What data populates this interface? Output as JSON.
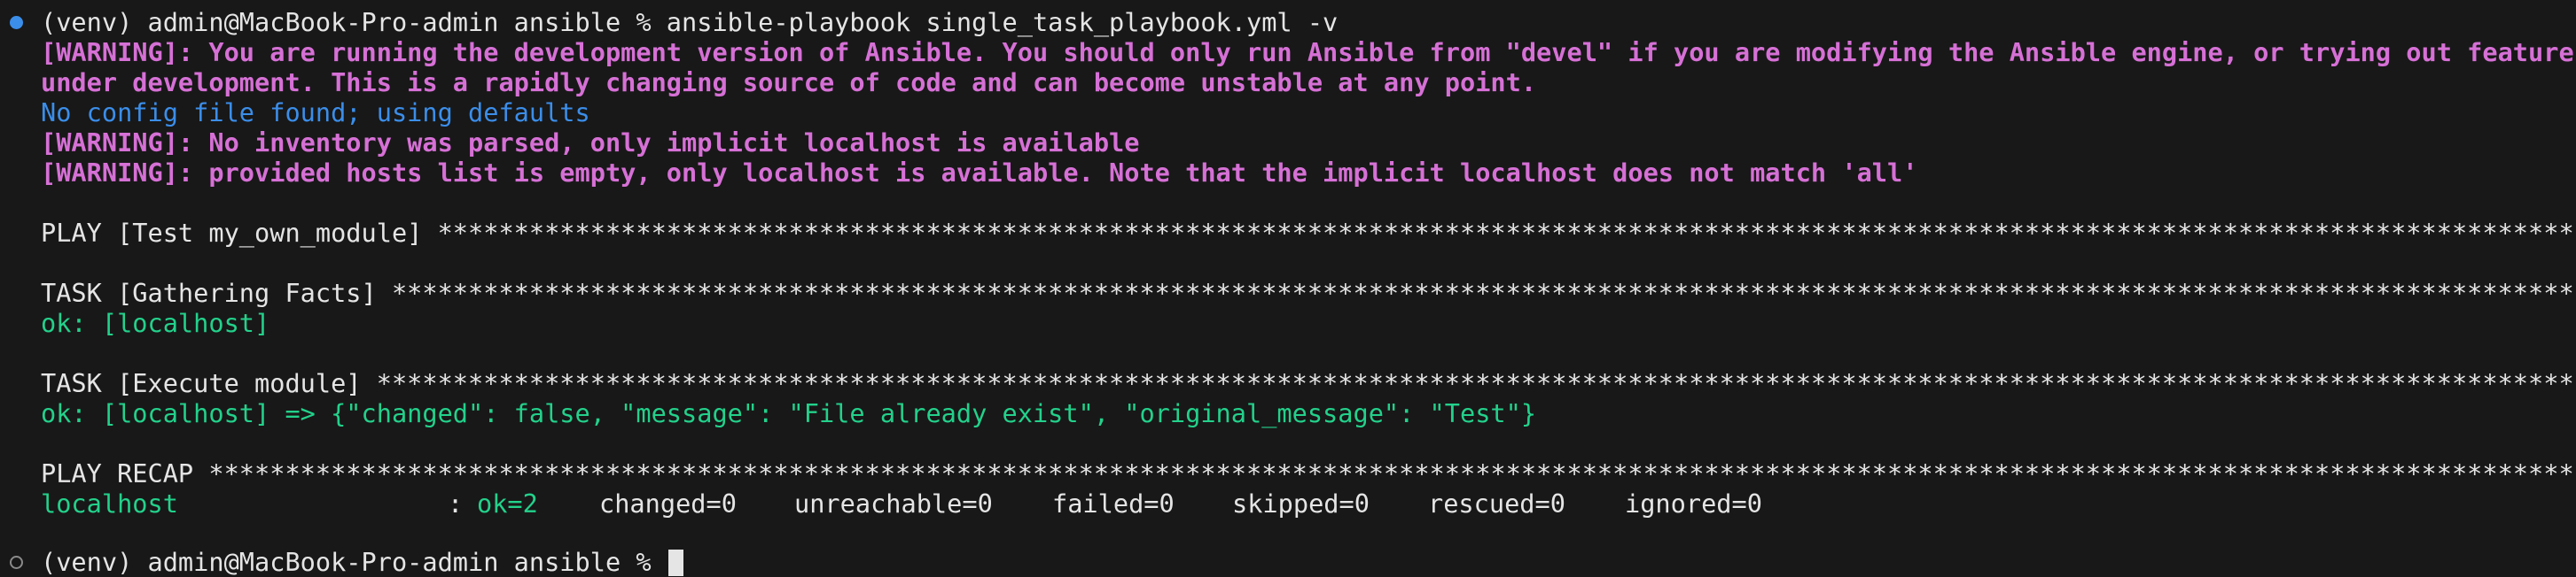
{
  "terminal": {
    "prompt1": "(venv) admin@MacBook-Pro-admin ansible % ansible-playbook single_task_playbook.yml -v",
    "warn_dev_1": "[WARNING]: You are running the development version of Ansible. You should only run Ansible from \"devel\" if you are modifying the Ansible engine, or trying out features",
    "warn_dev_2": "under development. This is a rapidly changing source of code and can become unstable at any point.",
    "config": "No config file found; using defaults",
    "warn_inventory": "[WARNING]: No inventory was parsed, only implicit localhost is available",
    "warn_hosts": "[WARNING]: provided hosts list is empty, only localhost is available. Note that the implicit localhost does not match 'all'",
    "play_header": "PLAY [Test my_own_module] ****************************************************************************************************************************************************",
    "task1_header": "TASK [Gathering Facts] *******************************************************************************************************************************************************",
    "task1_result": "ok: [localhost]",
    "task2_header": "TASK [Execute module] ********************************************************************************************************************************************************",
    "task2_result": "ok: [localhost] => {\"changed\": false, \"message\": \"File already exist\", \"original_message\": \"Test\"}",
    "recap_header": "PLAY RECAP *******************************************************************************************************************************************************************",
    "recap": {
      "host": "localhost",
      "sep": ":",
      "ok": "ok=2",
      "changed": "changed=0",
      "unreachable": "unreachable=0",
      "failed": "failed=0",
      "skipped": "skipped=0",
      "rescued": "rescued=0",
      "ignored": "ignored=0"
    },
    "prompt2": "(venv) admin@MacBook-Pro-admin ansible % "
  },
  "colors": {
    "background": "#181818",
    "text": "#d4d4d4",
    "warning": "#d670d6",
    "info": "#3b8eea",
    "ok": "#23d18b"
  },
  "icons": {
    "command_status_done": "filled-circle-icon",
    "command_status_pending": "hollow-circle-icon"
  }
}
